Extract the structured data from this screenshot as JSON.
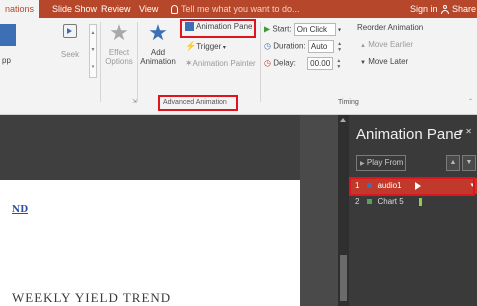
{
  "tabs": [
    {
      "label": "nations",
      "active": true
    },
    {
      "label": "Slide Show"
    },
    {
      "label": "Review"
    },
    {
      "label": "View"
    }
  ],
  "tell_me": "Tell me what you want to do...",
  "sign_in": "Sign in",
  "share": "Share",
  "ribbon": {
    "preview_label": "pp",
    "seek_label": "Seek",
    "effect_options_1": "Effect",
    "effect_options_2": "Options",
    "add_animation_1": "Add",
    "add_animation_2": "Animation",
    "animation_pane": "Animation Pane",
    "trigger": "Trigger",
    "animation_painter": "Animation Painter",
    "advanced_animation_group": "Advanced Animation",
    "start_label": "Start:",
    "start_value": "On Click",
    "duration_label": "Duration:",
    "duration_value": "Auto",
    "delay_label": "Delay:",
    "delay_value": "00.00",
    "timing_group": "Timing",
    "reorder_title": "Reorder Animation",
    "move_earlier": "Move Earlier",
    "move_later": "Move Later"
  },
  "pane": {
    "title": "Animation Pane",
    "play_from": "Play From",
    "items": [
      {
        "num": "1",
        "name": "audio1",
        "selected": true
      },
      {
        "num": "2",
        "name": "Chart 5",
        "selected": false
      }
    ]
  },
  "slide": {
    "heading": "ND",
    "text": "WEEKLY YIELD TREND"
  },
  "colors": {
    "accent": "#b7472a",
    "highlight": "#e0141e",
    "selected_item": "#c0392b"
  }
}
